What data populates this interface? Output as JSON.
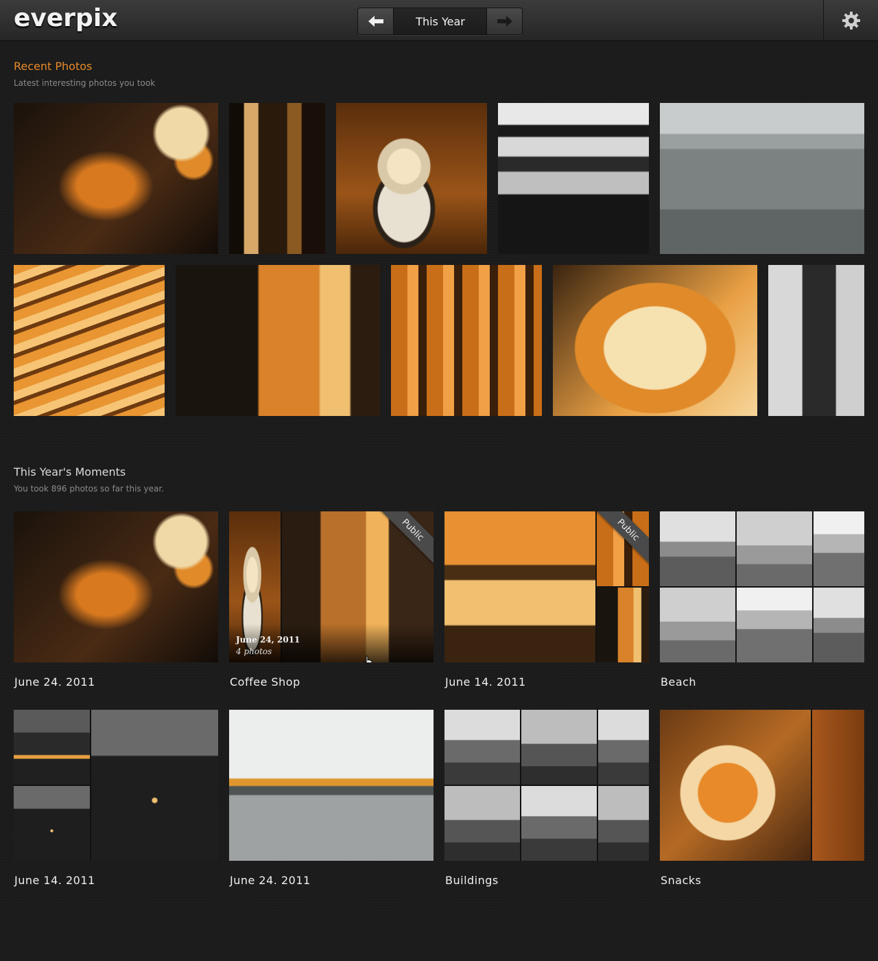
{
  "header": {
    "logo": "everpix",
    "nav_title": "This Year",
    "prev_icon": "arrow-left-icon",
    "next_icon": "arrow-right-icon",
    "settings_icon": "gear-icon"
  },
  "recent": {
    "title": "Recent Photos",
    "subtitle": "Latest interesting photos you took"
  },
  "moments": {
    "title": "This Year's Moments",
    "subtitle": "You took 896 photos so far this year.",
    "items": [
      {
        "label": "June 24. 2011"
      },
      {
        "label": "Coffee Shop",
        "badge": "Public",
        "overlay_date": "June 24, 2011",
        "overlay_count": "4 photos"
      },
      {
        "label": "June 14. 2011",
        "badge": "Public"
      },
      {
        "label": "Beach"
      },
      {
        "label": "June 14. 2011"
      },
      {
        "label": "June 24. 2011"
      },
      {
        "label": "Buildings"
      },
      {
        "label": "Snacks"
      }
    ]
  },
  "colors": {
    "accent": "#e98a2a",
    "background": "#1b1b1b"
  }
}
